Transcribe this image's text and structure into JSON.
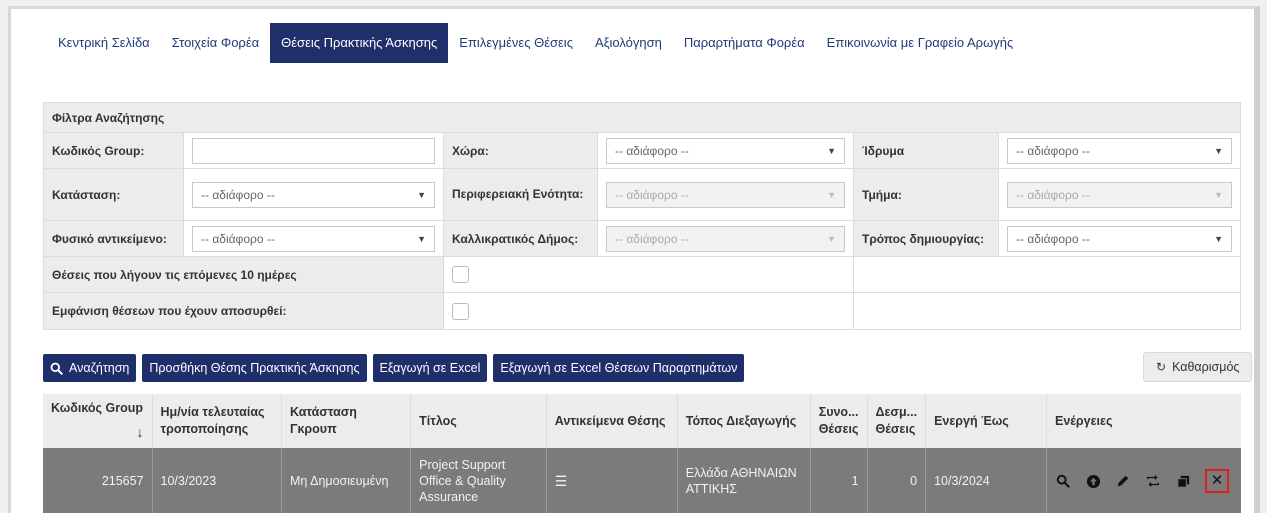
{
  "tabs": [
    {
      "label": "Κεντρική Σελίδα"
    },
    {
      "label": "Στοιχεία Φορέα"
    },
    {
      "label": "Θέσεις Πρακτικής Άσκησης"
    },
    {
      "label": "Επιλεγμένες Θέσεις"
    },
    {
      "label": "Αξιολόγηση"
    },
    {
      "label": "Παραρτήματα Φορέα"
    },
    {
      "label": "Επικοινωνία με Γραφείο Αρωγής"
    }
  ],
  "active_tab": "Θέσεις Πρακτικής Άσκησης",
  "filters": {
    "title": "Φίλτρα Αναζήτησης",
    "group_code_label": "Κωδικός Group:",
    "group_code_value": "",
    "country_label": "Χώρα:",
    "country_value": "-- αδιάφορο --",
    "institution_label": "Ίδρυμα",
    "institution_value": "-- αδιάφορο --",
    "status_label": "Κατάσταση:",
    "status_value": "-- αδιάφορο --",
    "regional_unit_label": "Περιφερειακή Ενότητα:",
    "regional_unit_value": "-- αδιάφορο --",
    "department_label": "Τμήμα:",
    "department_value": "-- αδιάφορο --",
    "physical_object_label": "Φυσικό αντικείμενο:",
    "physical_object_value": "-- αδιάφορο --",
    "kallikratis_label": "Καλλικρατικός Δήμος:",
    "kallikratis_value": "-- αδιάφορο --",
    "creation_mode_label": "Τρόπος δημιουργίας:",
    "creation_mode_value": "-- αδιάφορο --",
    "expiring_label": "Θέσεις που λήγουν τις επόμενες 10 ημέρες",
    "withdrawn_label": "Εμφάνιση θέσεων που έχουν αποσυρθεί:"
  },
  "buttons": {
    "search": "Αναζήτηση",
    "add_position": "Προσθήκη Θέσης Πρακτικής Άσκησης",
    "export_excel": "Εξαγωγή σε Excel",
    "export_excel_branches": "Εξαγωγή σε Excel Θέσεων Παραρτημάτων",
    "clear": "Καθαρισμός"
  },
  "table": {
    "headers": {
      "group_code": "Κωδικός Group",
      "last_modified": "Ημ/νία τελευταίας τροποποίησης",
      "group_status": "Κατάσταση Γκρουπ",
      "title": "Τίτλος",
      "objects": "Αντικείμενα Θέσης",
      "location": "Τόπος Διεξαγωγής",
      "total_positions": "Συνο... Θέσεις",
      "committed_positions": "Δεσμ... Θέσεις",
      "active_until": "Ενεργή Έως",
      "actions": "Ενέργειες"
    },
    "rows": [
      {
        "group_code": "215657",
        "last_modified": "10/3/2023",
        "group_status": "Μη Δημοσιευμένη",
        "title": "Project Support Office & Quality Assurance",
        "objects_icon": "list-icon",
        "location": "Ελλάδα ΑΘΗΝΑΙΩΝ ΑΤΤΙΚΗΣ",
        "total_positions": "1",
        "committed_positions": "0",
        "active_until": "10/3/2024"
      }
    ]
  },
  "colors": {
    "primary": "#1e2f6c",
    "row_bg": "#7b7b7b",
    "highlight": "#e0201c"
  }
}
